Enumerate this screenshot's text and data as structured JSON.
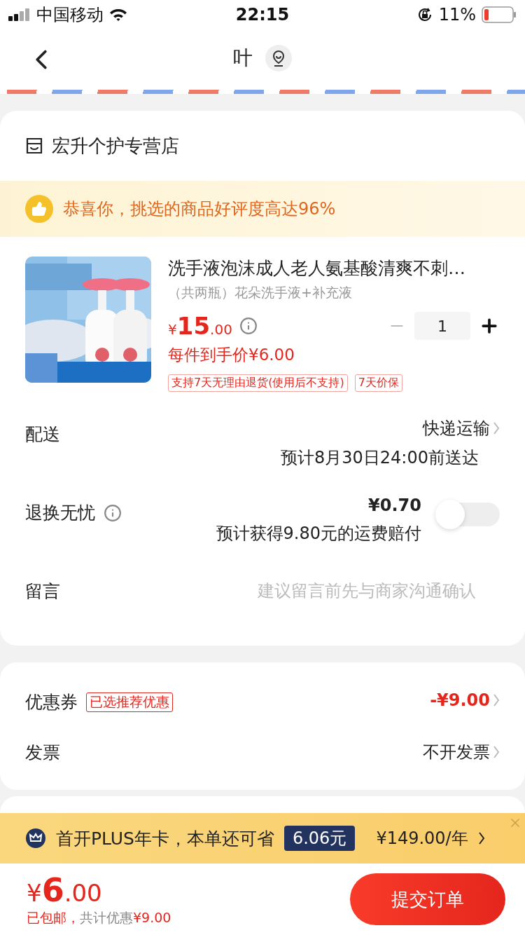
{
  "status_bar": {
    "carrier": "中国移动",
    "time": "22:15",
    "battery": "11%"
  },
  "nav": {
    "title": "叶"
  },
  "store": {
    "name": "宏升个护专营店"
  },
  "rating_banner": {
    "text": "恭喜你，挑选的商品好评度高达96%"
  },
  "product": {
    "title": "洗手液泡沫成人老人氨基酸清爽不刺…",
    "variant": "（共两瓶）花朵洗手液+补充液",
    "price_symbol": "¥",
    "price_int": "15",
    "price_dec": ".00",
    "unit_price": "每件到手价¥6.00",
    "quantity": "1",
    "tags": [
      "支持7天无理由退货(使用后不支持)",
      "7天价保"
    ]
  },
  "delivery": {
    "label": "配送",
    "method": "快递运输",
    "eta": "预计8月30日24:00前送达"
  },
  "return_insurance": {
    "label": "退换无忧",
    "price": "¥0.70",
    "note": "预计获得9.80元的运费赔付",
    "on": false
  },
  "message": {
    "label": "留言",
    "placeholder": "建议留言前先与商家沟通确认"
  },
  "coupon": {
    "label": "优惠券",
    "badge": "已选推荐优惠",
    "value": "-¥9.00"
  },
  "invoice": {
    "label": "发票",
    "value": "不开发票"
  },
  "plus_banner": {
    "text": "首开PLUS年卡，本单还可省",
    "saving": "6.06元",
    "price": "¥149.00/年"
  },
  "footer": {
    "currency": "¥",
    "amount_int": "6",
    "amount_dec": ".00",
    "shipping": "已包邮，",
    "discount_label": "共计优惠",
    "discount": "¥9.00",
    "submit": "提交订单"
  }
}
